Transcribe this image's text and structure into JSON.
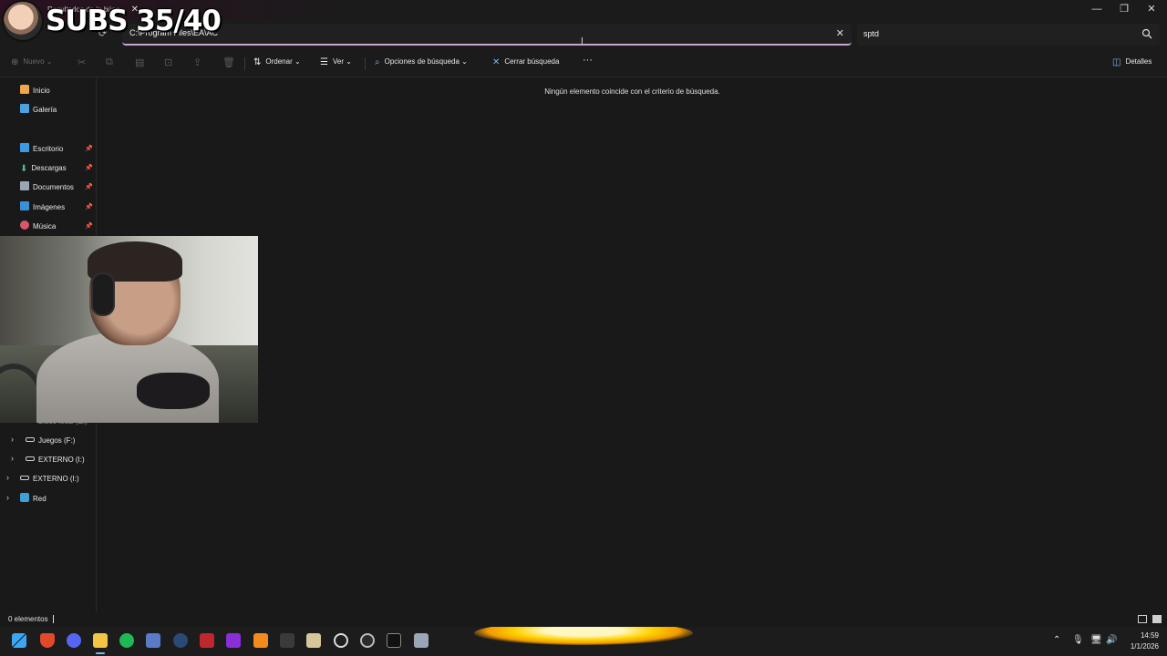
{
  "window": {
    "tab_title": "Resultados de la búsq...",
    "minimize": "—",
    "maximize": "❐",
    "close": "✕"
  },
  "overlay": {
    "text": "SUBS 35/40"
  },
  "address": {
    "path": "C:\\Program Files\\EA\\AC",
    "clear": "✕"
  },
  "search": {
    "value": "sptd"
  },
  "commands": {
    "new": "Nuevo",
    "sort": "Ordenar",
    "view": "Ver",
    "search_options": "Opciones de búsqueda",
    "close_search": "Cerrar búsqueda",
    "more": "···",
    "details": "Detalles"
  },
  "sidebar": {
    "items": [
      {
        "label": "Inicio",
        "icon": "home-icon"
      },
      {
        "label": "Galería",
        "icon": "gallery-icon"
      },
      {
        "label": "Escritorio",
        "icon": "desktop-icon"
      },
      {
        "label": "Descargas",
        "icon": "downloads-icon"
      },
      {
        "label": "Documentos",
        "icon": "documents-icon"
      },
      {
        "label": "Imágenes",
        "icon": "pictures-icon"
      },
      {
        "label": "Música",
        "icon": "music-icon"
      }
    ],
    "drives": [
      {
        "label": "Disco local (E:)"
      },
      {
        "label": "Juegos (F:)"
      },
      {
        "label": "EXTERNO (I:)"
      },
      {
        "label": "EXTERNO (I:)"
      },
      {
        "label": "Red"
      }
    ]
  },
  "main": {
    "empty_message": "Ningún elemento coincide con el criterio de búsqueda."
  },
  "status": {
    "count": "0 elementos"
  },
  "clock": {
    "time": "14:59",
    "date": "1/1/2026"
  },
  "colors": {
    "accent": "#c9a4d6",
    "background": "#191919",
    "taskbar_glow": "#ffd200"
  }
}
